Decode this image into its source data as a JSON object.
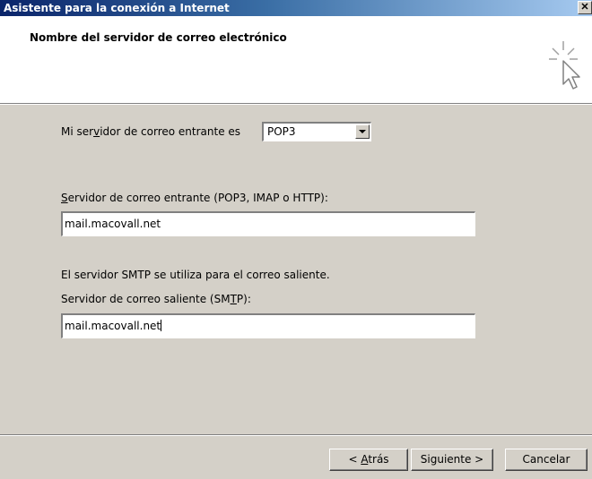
{
  "window": {
    "title": "Asistente para la conexión a Internet",
    "close_glyph": "✕"
  },
  "header": {
    "title": "Nombre del servidor de correo electrónico",
    "icon": "wizard-cursor-icon"
  },
  "incoming_type": {
    "label_pre": "Mi ser",
    "label_mnemonic": "v",
    "label_post": "idor de correo entrante es",
    "selected": "POP3"
  },
  "incoming_server": {
    "label_mnemonic": "S",
    "label_post": "ervidor de correo entrante (POP3, IMAP o HTTP):",
    "value": "mail.macovall.net"
  },
  "smtp_note": "El servidor SMTP se utiliza para el correo saliente.",
  "outgoing_server": {
    "label_pre": "Servidor de correo saliente (SM",
    "label_mnemonic": "T",
    "label_post": "P):",
    "value": "mail.macovall.net"
  },
  "buttons": {
    "back_pre": "< ",
    "back_mnemonic": "A",
    "back_post": "trás",
    "next": "Siguiente >",
    "cancel": "Cancelar"
  }
}
